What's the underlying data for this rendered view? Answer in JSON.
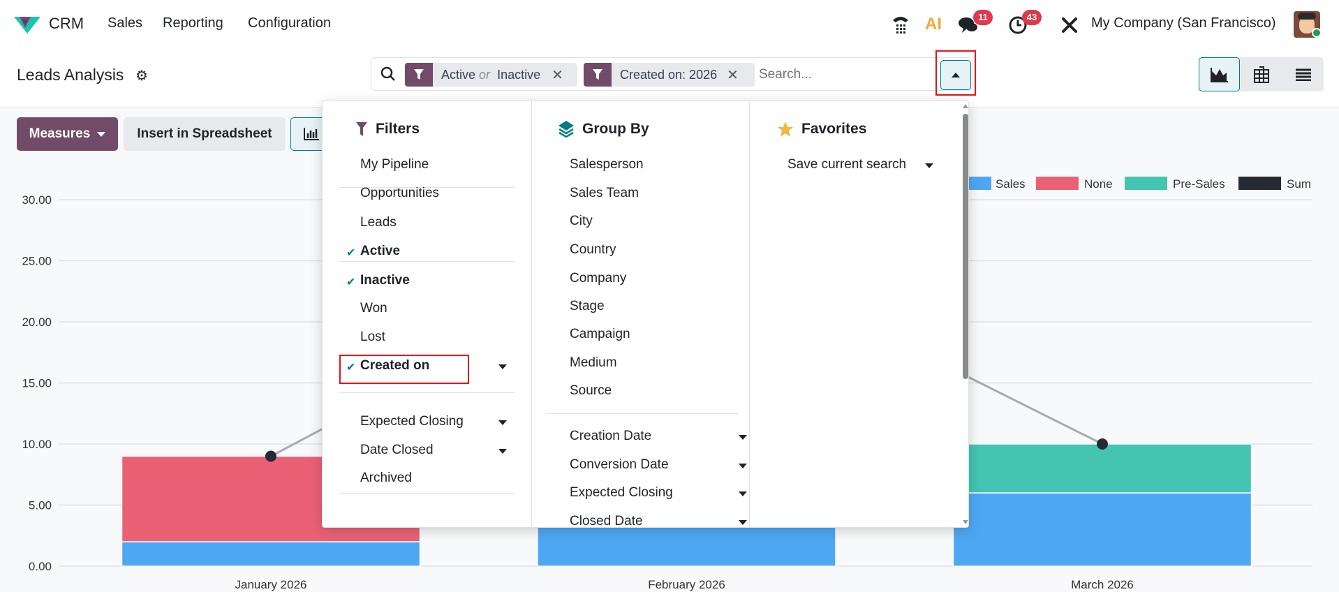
{
  "app": {
    "name": "CRM",
    "menu": [
      "Sales",
      "Reporting",
      "Configuration"
    ],
    "company": "My Company (San Francisco)",
    "messages_count": "11",
    "activities_count": "43",
    "ai_label": "AI"
  },
  "page": {
    "title": "Leads Analysis"
  },
  "search": {
    "facets": [
      {
        "parts": [
          "Active",
          " or ",
          "Inactive"
        ]
      },
      {
        "label": "Created on: 2026"
      }
    ],
    "placeholder": "Search..."
  },
  "toolbar": {
    "measures": "Measures",
    "insert": "Insert in Spreadsheet"
  },
  "dropdown": {
    "filters": {
      "title": "Filters",
      "groups": [
        [
          {
            "label": "My Pipeline"
          }
        ],
        [
          {
            "label": "Opportunities"
          },
          {
            "label": "Leads"
          }
        ],
        [
          {
            "label": "Active",
            "checked": true
          },
          {
            "label": "Inactive",
            "checked": true
          },
          {
            "label": "Won"
          },
          {
            "label": "Lost"
          }
        ],
        [
          {
            "label": "Created on",
            "checked": true,
            "caret": true
          },
          {
            "label": "Expected Closing",
            "caret": true
          },
          {
            "label": "Date Closed",
            "caret": true
          }
        ],
        [
          {
            "label": "Archived"
          }
        ]
      ]
    },
    "groupby": {
      "title": "Group By",
      "groups": [
        [
          {
            "label": "Salesperson"
          },
          {
            "label": "Sales Team"
          },
          {
            "label": "City"
          },
          {
            "label": "Country"
          },
          {
            "label": "Company"
          },
          {
            "label": "Stage"
          },
          {
            "label": "Campaign"
          },
          {
            "label": "Medium"
          },
          {
            "label": "Source"
          }
        ],
        [
          {
            "label": "Creation Date",
            "caret": true
          },
          {
            "label": "Conversion Date",
            "caret": true
          },
          {
            "label": "Expected Closing",
            "caret": true
          },
          {
            "label": "Closed Date",
            "caret": true
          }
        ]
      ]
    },
    "favorites": {
      "title": "Favorites",
      "items": [
        {
          "label": "Save current search",
          "caret": true
        }
      ]
    }
  },
  "chart_data": {
    "type": "bar",
    "stacked": true,
    "categories": [
      "January 2026",
      "February 2026",
      "March 2026"
    ],
    "series": [
      {
        "name": "Sales",
        "color": "#4ea7f2",
        "values": [
          2,
          12,
          6
        ]
      },
      {
        "name": "None",
        "color": "#ea6175",
        "values": [
          7,
          9,
          0
        ]
      },
      {
        "name": "Pre-Sales",
        "color": "#43c5b1",
        "values": [
          0,
          6,
          4
        ]
      },
      {
        "name": "Sum",
        "color": "#252a34",
        "type": "line",
        "values": [
          9,
          27,
          10
        ]
      }
    ],
    "yticks": [
      "0.00",
      "5.00",
      "10.00",
      "15.00",
      "20.00",
      "25.00",
      "30.00"
    ],
    "ylim": [
      0,
      30
    ],
    "legend": "top-right",
    "grid": true
  }
}
